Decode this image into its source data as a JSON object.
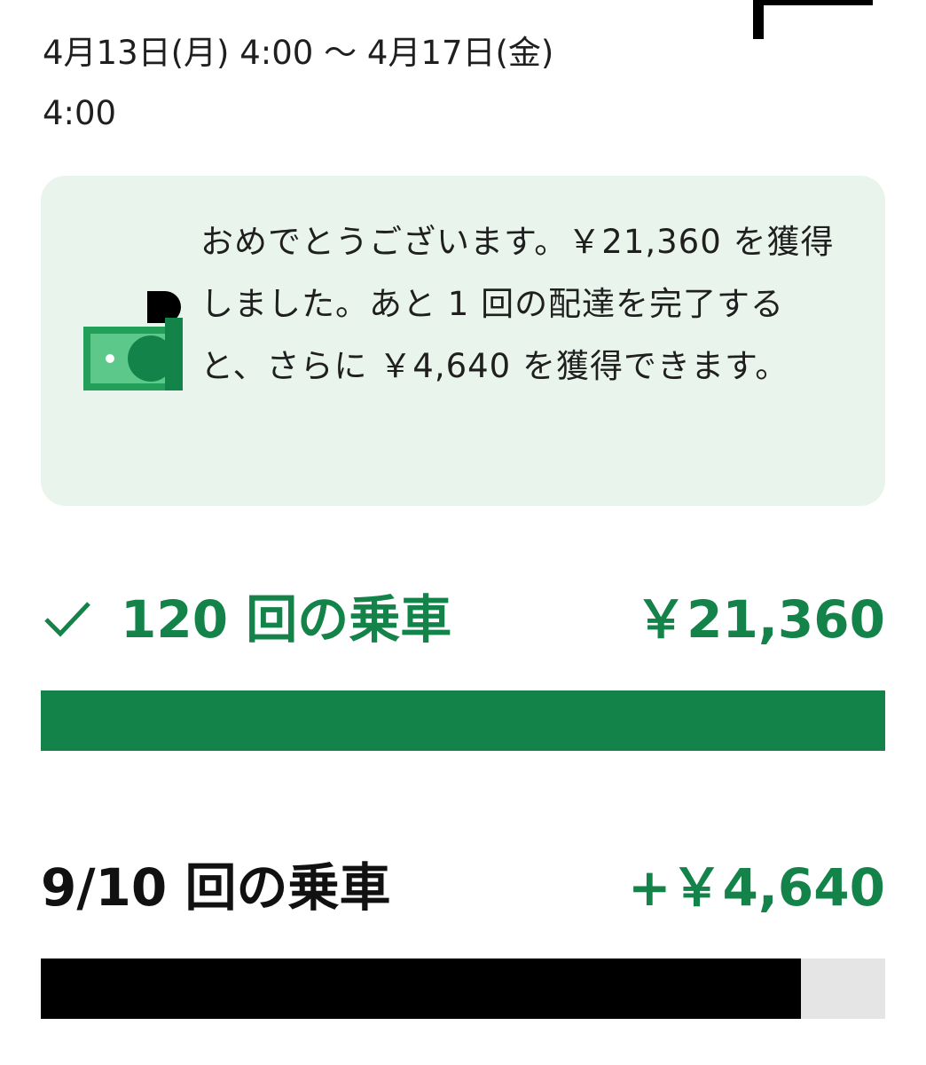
{
  "header": {
    "period_line1": "4月13日(月) 4:00 〜 4月17日(金)",
    "period_line2": "4:00"
  },
  "banner": {
    "message": "おめでとうございます。￥21,360 を獲得しました。あと 1 回の配達を完了すると、さらに ￥4,640 を獲得できます。",
    "icon": "money-icon"
  },
  "tiers": [
    {
      "label": "120 回の乗車",
      "amount": "￥21,360",
      "completed": true,
      "progress": 1.0,
      "icon": "check-icon"
    },
    {
      "label": "9/10 回の乗車",
      "amount": "+￥4,640",
      "completed": false,
      "progress": 0.9
    }
  ],
  "colors": {
    "accent_green": "#13834a",
    "banner_bg": "#e9f4ec",
    "track": "#e5e5e5",
    "progress_dark": "#000000"
  }
}
